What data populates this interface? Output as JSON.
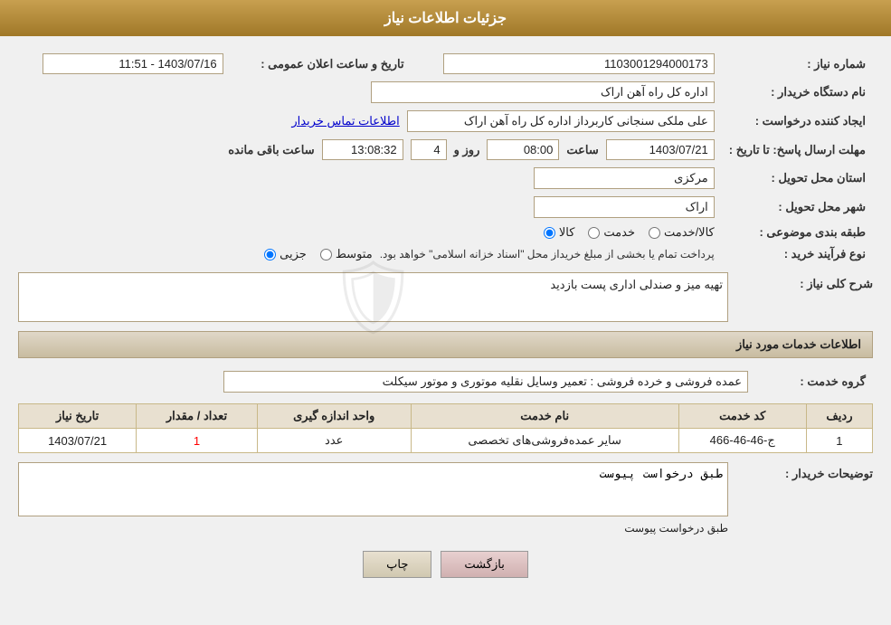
{
  "header": {
    "title": "جزئیات اطلاعات نیاز"
  },
  "fields": {
    "need_number_label": "شماره نیاز :",
    "need_number_value": "1103001294000173",
    "buyer_org_label": "نام دستگاه خریدار :",
    "buyer_org_value": "اداره کل راه آهن اراک",
    "requester_label": "ایجاد کننده درخواست :",
    "requester_value": "علی ملکی سنجانی کاربرداز اداره کل راه آهن اراک",
    "requester_link": "اطلاعات تماس خریدار",
    "deadline_label": "مهلت ارسال پاسخ: تا تاریخ :",
    "deadline_date": "1403/07/21",
    "deadline_time_label": "ساعت",
    "deadline_time": "08:00",
    "deadline_days_label": "روز و",
    "deadline_days": "4",
    "deadline_remaining_label": "ساعت باقی مانده",
    "deadline_remaining": "13:08:32",
    "province_label": "استان محل تحویل :",
    "province_value": "مرکزی",
    "city_label": "شهر محل تحویل :",
    "city_value": "اراک",
    "announcement_label": "تاریخ و ساعت اعلان عمومی :",
    "announcement_value": "1403/07/16 - 11:51",
    "category_label": "طبقه بندی موضوعی :",
    "category_options": [
      "کالا",
      "خدمت",
      "کالا/خدمت"
    ],
    "category_selected": "کالا",
    "purchase_type_label": "نوع فرآیند خرید :",
    "purchase_type_options": [
      "جزیی",
      "متوسط"
    ],
    "purchase_type_note": "پرداخت تمام یا بخشی از مبلغ خریداز محل \"اسناد خزانه اسلامی\" خواهد بود.",
    "need_desc_label": "شرح کلی نیاز :",
    "need_desc_value": "تهیه میز و صندلی اداری پست بازدید",
    "services_section_label": "اطلاعات خدمات مورد نیاز",
    "service_group_label": "گروه خدمت :",
    "service_group_value": "عمده فروشی و خرده فروشی : تعمیر وسایل نقلیه موتوری و موتور سیکلت",
    "table_headers": [
      "ردیف",
      "کد خدمت",
      "نام خدمت",
      "واحد اندازه گیری",
      "تعداد / مقدار",
      "تاریخ نیاز"
    ],
    "table_rows": [
      {
        "row": "1",
        "code": "ج-46-46-466",
        "name": "سایر عمده‌فروشی‌های تخصصی",
        "unit": "عدد",
        "quantity": "1",
        "date": "1403/07/21"
      }
    ],
    "buyer_desc_label": "توضیحات خریدار :",
    "buyer_desc_value": "طبق درخواست پیوست"
  },
  "buttons": {
    "print": "چاپ",
    "back": "بازگشت"
  }
}
